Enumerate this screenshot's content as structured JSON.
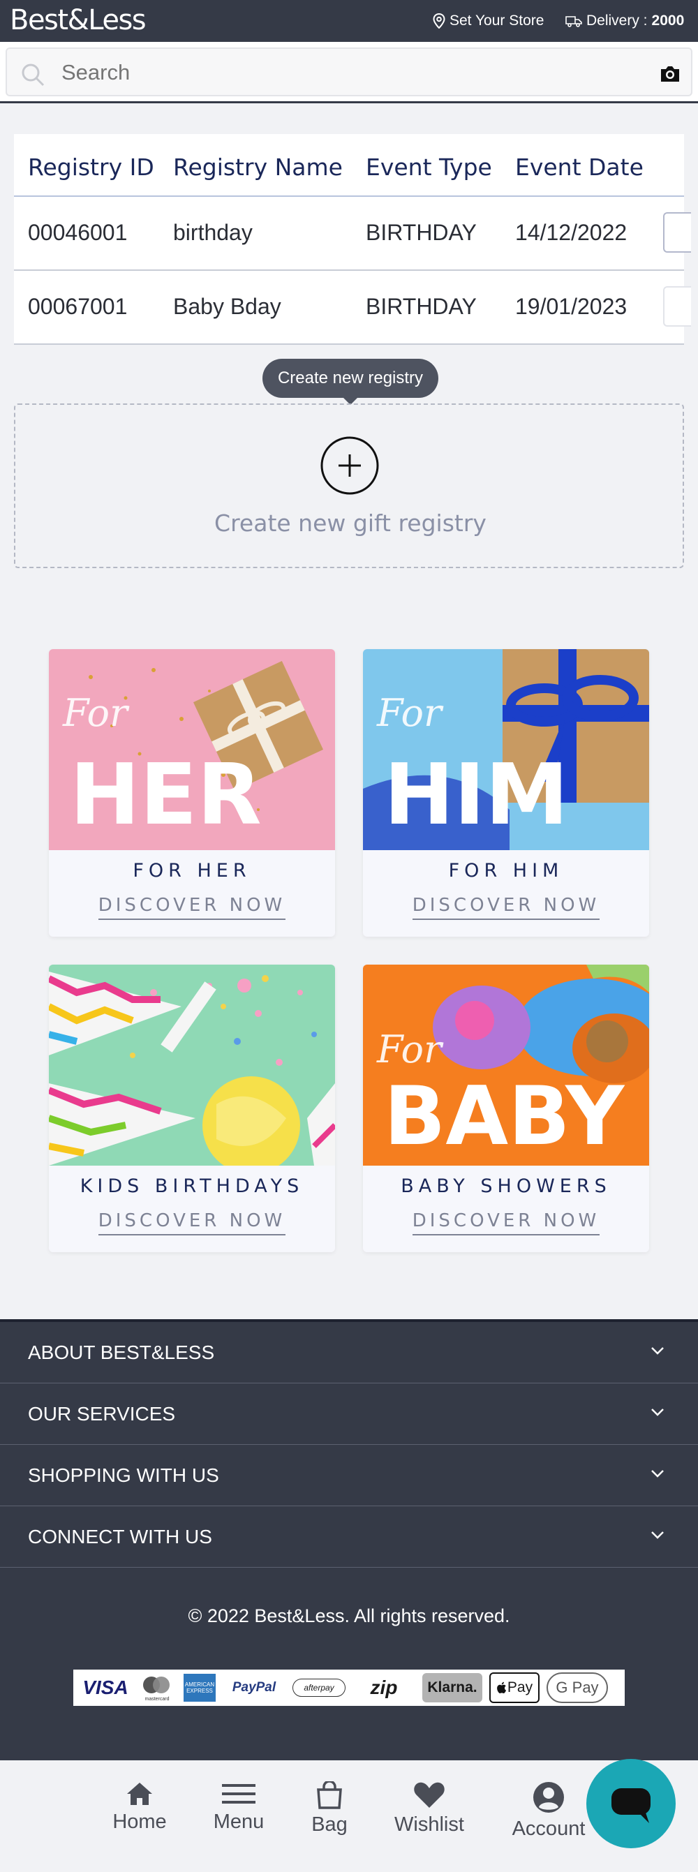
{
  "header": {
    "logo": "Best&Less",
    "store_label": "Set Your Store",
    "delivery_label": "Delivery :",
    "delivery_postcode": "2000"
  },
  "search": {
    "placeholder": "Search"
  },
  "registry_table": {
    "columns": [
      "Registry ID",
      "Registry Name",
      "Event Type",
      "Event Date"
    ],
    "rows": [
      {
        "id": "00046001",
        "name": "birthday",
        "type": "BIRTHDAY",
        "date": "14/12/2022"
      },
      {
        "id": "00067001",
        "name": "Baby Bday",
        "type": "BIRTHDAY",
        "date": "19/01/2023"
      }
    ]
  },
  "tooltip": "Create new registry",
  "create": {
    "label": "Create new gift registry"
  },
  "categories": [
    {
      "title": "FOR HER",
      "image_word": "HER",
      "script": "For",
      "link": "DISCOVER NOW"
    },
    {
      "title": "FOR HIM",
      "image_word": "HIM",
      "script": "For",
      "link": "DISCOVER NOW"
    },
    {
      "title": "KIDS BIRTHDAYS",
      "link": "DISCOVER NOW"
    },
    {
      "title": "BABY SHOWERS",
      "image_word": "BABY",
      "script": "For",
      "link": "DISCOVER NOW"
    }
  ],
  "footer": {
    "sections": [
      "ABOUT BEST&LESS",
      "OUR SERVICES",
      "SHOPPING WITH US",
      "CONNECT WITH US"
    ],
    "copyright": "© 2022 Best&Less. All rights reserved.",
    "payments": {
      "visa": "VISA",
      "mastercard": "mastercard",
      "amex": "AMERICAN EXPRESS",
      "paypal": "PayPal",
      "afterpay": "afterpay",
      "zip": "zip",
      "klarna": "Klarna.",
      "applepay": "Pay",
      "gpay": "G Pay"
    }
  },
  "bottom_nav": [
    "Home",
    "Menu",
    "Bag",
    "Wishlist",
    "Account"
  ],
  "colors": {
    "header_bg": "#353a47",
    "accent": "#1ba7b5",
    "heading": "#1a2759"
  }
}
